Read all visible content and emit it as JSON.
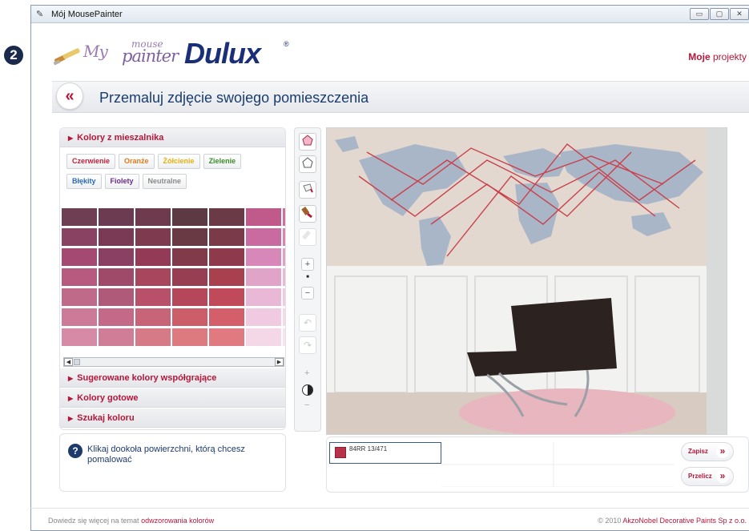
{
  "window": {
    "title": "Mój MousePainter"
  },
  "step_number": "2",
  "logo": {
    "my": "My",
    "mouse": "mouse",
    "painter": "painter",
    "brand": "Dulux",
    "reg": "®"
  },
  "header": {
    "my_projects_bold": "Moje",
    "my_projects_rest": " projekty",
    "back_symbol": "«",
    "title": "Przemaluj zdjęcie swojego pomieszczenia"
  },
  "mixer": {
    "title": "Kolory z mieszalnika",
    "families_row1": [
      {
        "label": "Czerwienie",
        "color": "#c0203a"
      },
      {
        "label": "Oranże",
        "color": "#e07a1a"
      },
      {
        "label": "Żółcienie",
        "color": "#e6b10f"
      },
      {
        "label": "Zielenie",
        "color": "#3c8a2a"
      }
    ],
    "families_row2": [
      {
        "label": "Błękity",
        "color": "#2a6ab5"
      },
      {
        "label": "Fiolety",
        "color": "#6a2a8a"
      },
      {
        "label": "Neutralne",
        "color": "#8a8a8a"
      }
    ],
    "swatch_rows": [
      [
        "#6e3e53",
        "#6b3b52",
        "#6e3a4e",
        "#5c3a44",
        "#6a3a46",
        "#c05a8a",
        "#d0709a"
      ],
      [
        "#8a4262",
        "#7a3a55",
        "#7e3a4f",
        "#6a3a44",
        "#7a3a48",
        "#c96aa0",
        "#d886b0"
      ],
      [
        "#a44a72",
        "#8a4062",
        "#933b56",
        "#803a4a",
        "#8e3a4c",
        "#d888b8",
        "#e4a0c4"
      ],
      [
        "#b85a80",
        "#a04a6a",
        "#a8465e",
        "#983e52",
        "#a8404e",
        "#e0a4c8",
        "#ecb8d4"
      ],
      [
        "#c06a8a",
        "#b05a7a",
        "#b8506a",
        "#b4485a",
        "#c04a5a",
        "#e8b8d6",
        "#f2cadf"
      ],
      [
        "#cc7a98",
        "#c46a88",
        "#c86478",
        "#cc5e6a",
        "#d45e6a",
        "#efcae0",
        "#f6dae8"
      ],
      [
        "#d68aa6",
        "#d07e98",
        "#d67a88",
        "#dc7a80",
        "#e07a80",
        "#f4d8e8",
        "#f9e4ee"
      ]
    ]
  },
  "sections": [
    {
      "label": "Sugerowane kolory współgrające"
    },
    {
      "label": "Kolory gotowe"
    },
    {
      "label": "Szukaj koloru"
    }
  ],
  "hint": {
    "icon": "?",
    "text": "Klikaj dookoła powierzchni, którą chcesz pomalować"
  },
  "tools": {
    "zoom_in": "+",
    "zoom_dot": "■",
    "zoom_out": "−",
    "bright_plus": "+",
    "bright_minus": "−"
  },
  "selected_color": {
    "code": "84RR 13/471",
    "color": "#b8334a"
  },
  "actions": {
    "save": "Zapisz",
    "recalc": "Przelicz",
    "chevron": "»"
  },
  "footer": {
    "left_prefix": "Dowiedz się więcej na temat ",
    "left_link": "odwzorowania kolorów",
    "right_prefix": "© 2010 ",
    "right_link": "AkzoNobel Decorative Paints Sp z o.o."
  }
}
